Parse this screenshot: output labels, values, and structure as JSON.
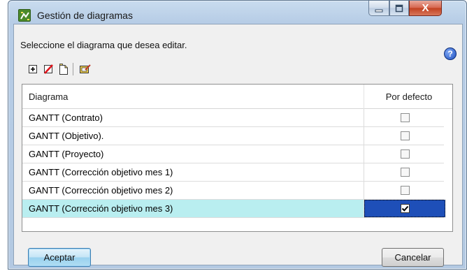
{
  "window": {
    "title": "Gestión de diagramas",
    "close_glyph": "X"
  },
  "prompt": "Seleccione el diagrama que desea editar.",
  "toolbar": {
    "items": [
      "add-diagram-icon",
      "delete-diagram-icon",
      "copy-diagram-icon",
      "edit-diagram-icon"
    ]
  },
  "table": {
    "columns": [
      "Diagrama",
      "Por defecto"
    ],
    "rows": [
      {
        "name": "GANTT (Contrato)",
        "default": false
      },
      {
        "name": "GANTT (Objetivo).",
        "default": false
      },
      {
        "name": "GANTT (Proyecto)",
        "default": false
      },
      {
        "name": "GANTT (Corrección objetivo mes 1)",
        "default": false
      },
      {
        "name": "GANTT (Corrección objetivo mes 2)",
        "default": false
      },
      {
        "name": "GANTT (Corrección objetivo mes 3)",
        "default": true
      }
    ],
    "selected_row": 5
  },
  "buttons": {
    "ok": "Aceptar",
    "cancel": "Cancelar"
  },
  "help_glyph": "?",
  "colors": {
    "selection": "#b9eef0",
    "focus_cell": "#1e4fb8"
  }
}
